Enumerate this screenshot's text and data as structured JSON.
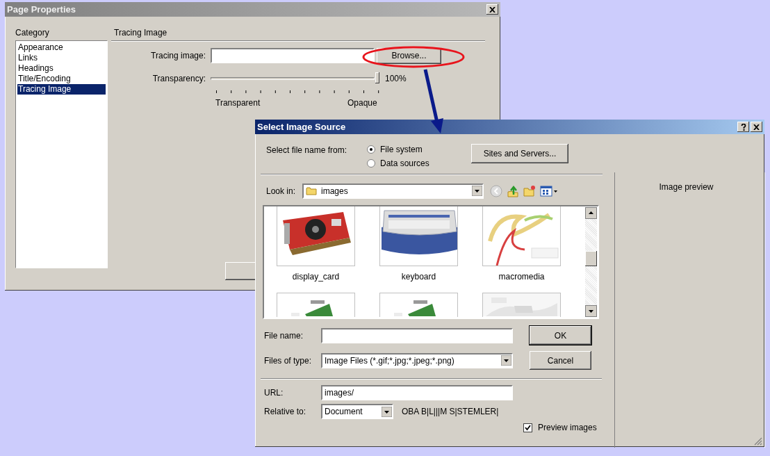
{
  "page_properties": {
    "title": "Page Properties",
    "category_label": "Category",
    "categories": [
      {
        "label": "Appearance",
        "selected": false
      },
      {
        "label": "Links",
        "selected": false
      },
      {
        "label": "Headings",
        "selected": false
      },
      {
        "label": "Title/Encoding",
        "selected": false
      },
      {
        "label": "Tracing Image",
        "selected": true
      }
    ],
    "section_title": "Tracing Image",
    "tracing_image": {
      "label": "Tracing image:"
    },
    "browse_button": "Browse...",
    "transparency": {
      "label": "Transparency:",
      "level": 1,
      "reading": "100%",
      "min_label": "Transparent",
      "max_label": "Opaque"
    }
  },
  "select_image_source": {
    "title": "Select Image Source",
    "source_label": "Select file name from:",
    "sources": [
      {
        "label": "File system",
        "selected": true
      },
      {
        "label": "Data sources",
        "selected": false
      }
    ],
    "sites_button": "Sites and Servers...",
    "look_in": {
      "label": "Look in:",
      "value": "images"
    },
    "files": [
      {
        "name": "display_card",
        "kind": "picture"
      },
      {
        "name": "keyboard",
        "kind": "picture"
      },
      {
        "name": "macromedia",
        "kind": "picture"
      },
      {
        "kind": "picture"
      },
      {
        "kind": "picture"
      },
      {
        "kind": "picture"
      }
    ],
    "file_name": {
      "label": "File name:"
    },
    "file_type": {
      "label": "Files of type:",
      "value": "Image Files (*.gif;*.jpg;*.jpeg;*.png)"
    },
    "ok_button": "OK",
    "cancel_button": "Cancel",
    "url": {
      "label": "URL:",
      "value": "images/"
    },
    "relative_to": {
      "label": "Relative to:",
      "value": "Document",
      "note": "OBA B|L|||M S|STEMLER|"
    },
    "preview_images": {
      "label": "Preview images",
      "checked": true
    },
    "preview_label": "Image preview"
  }
}
